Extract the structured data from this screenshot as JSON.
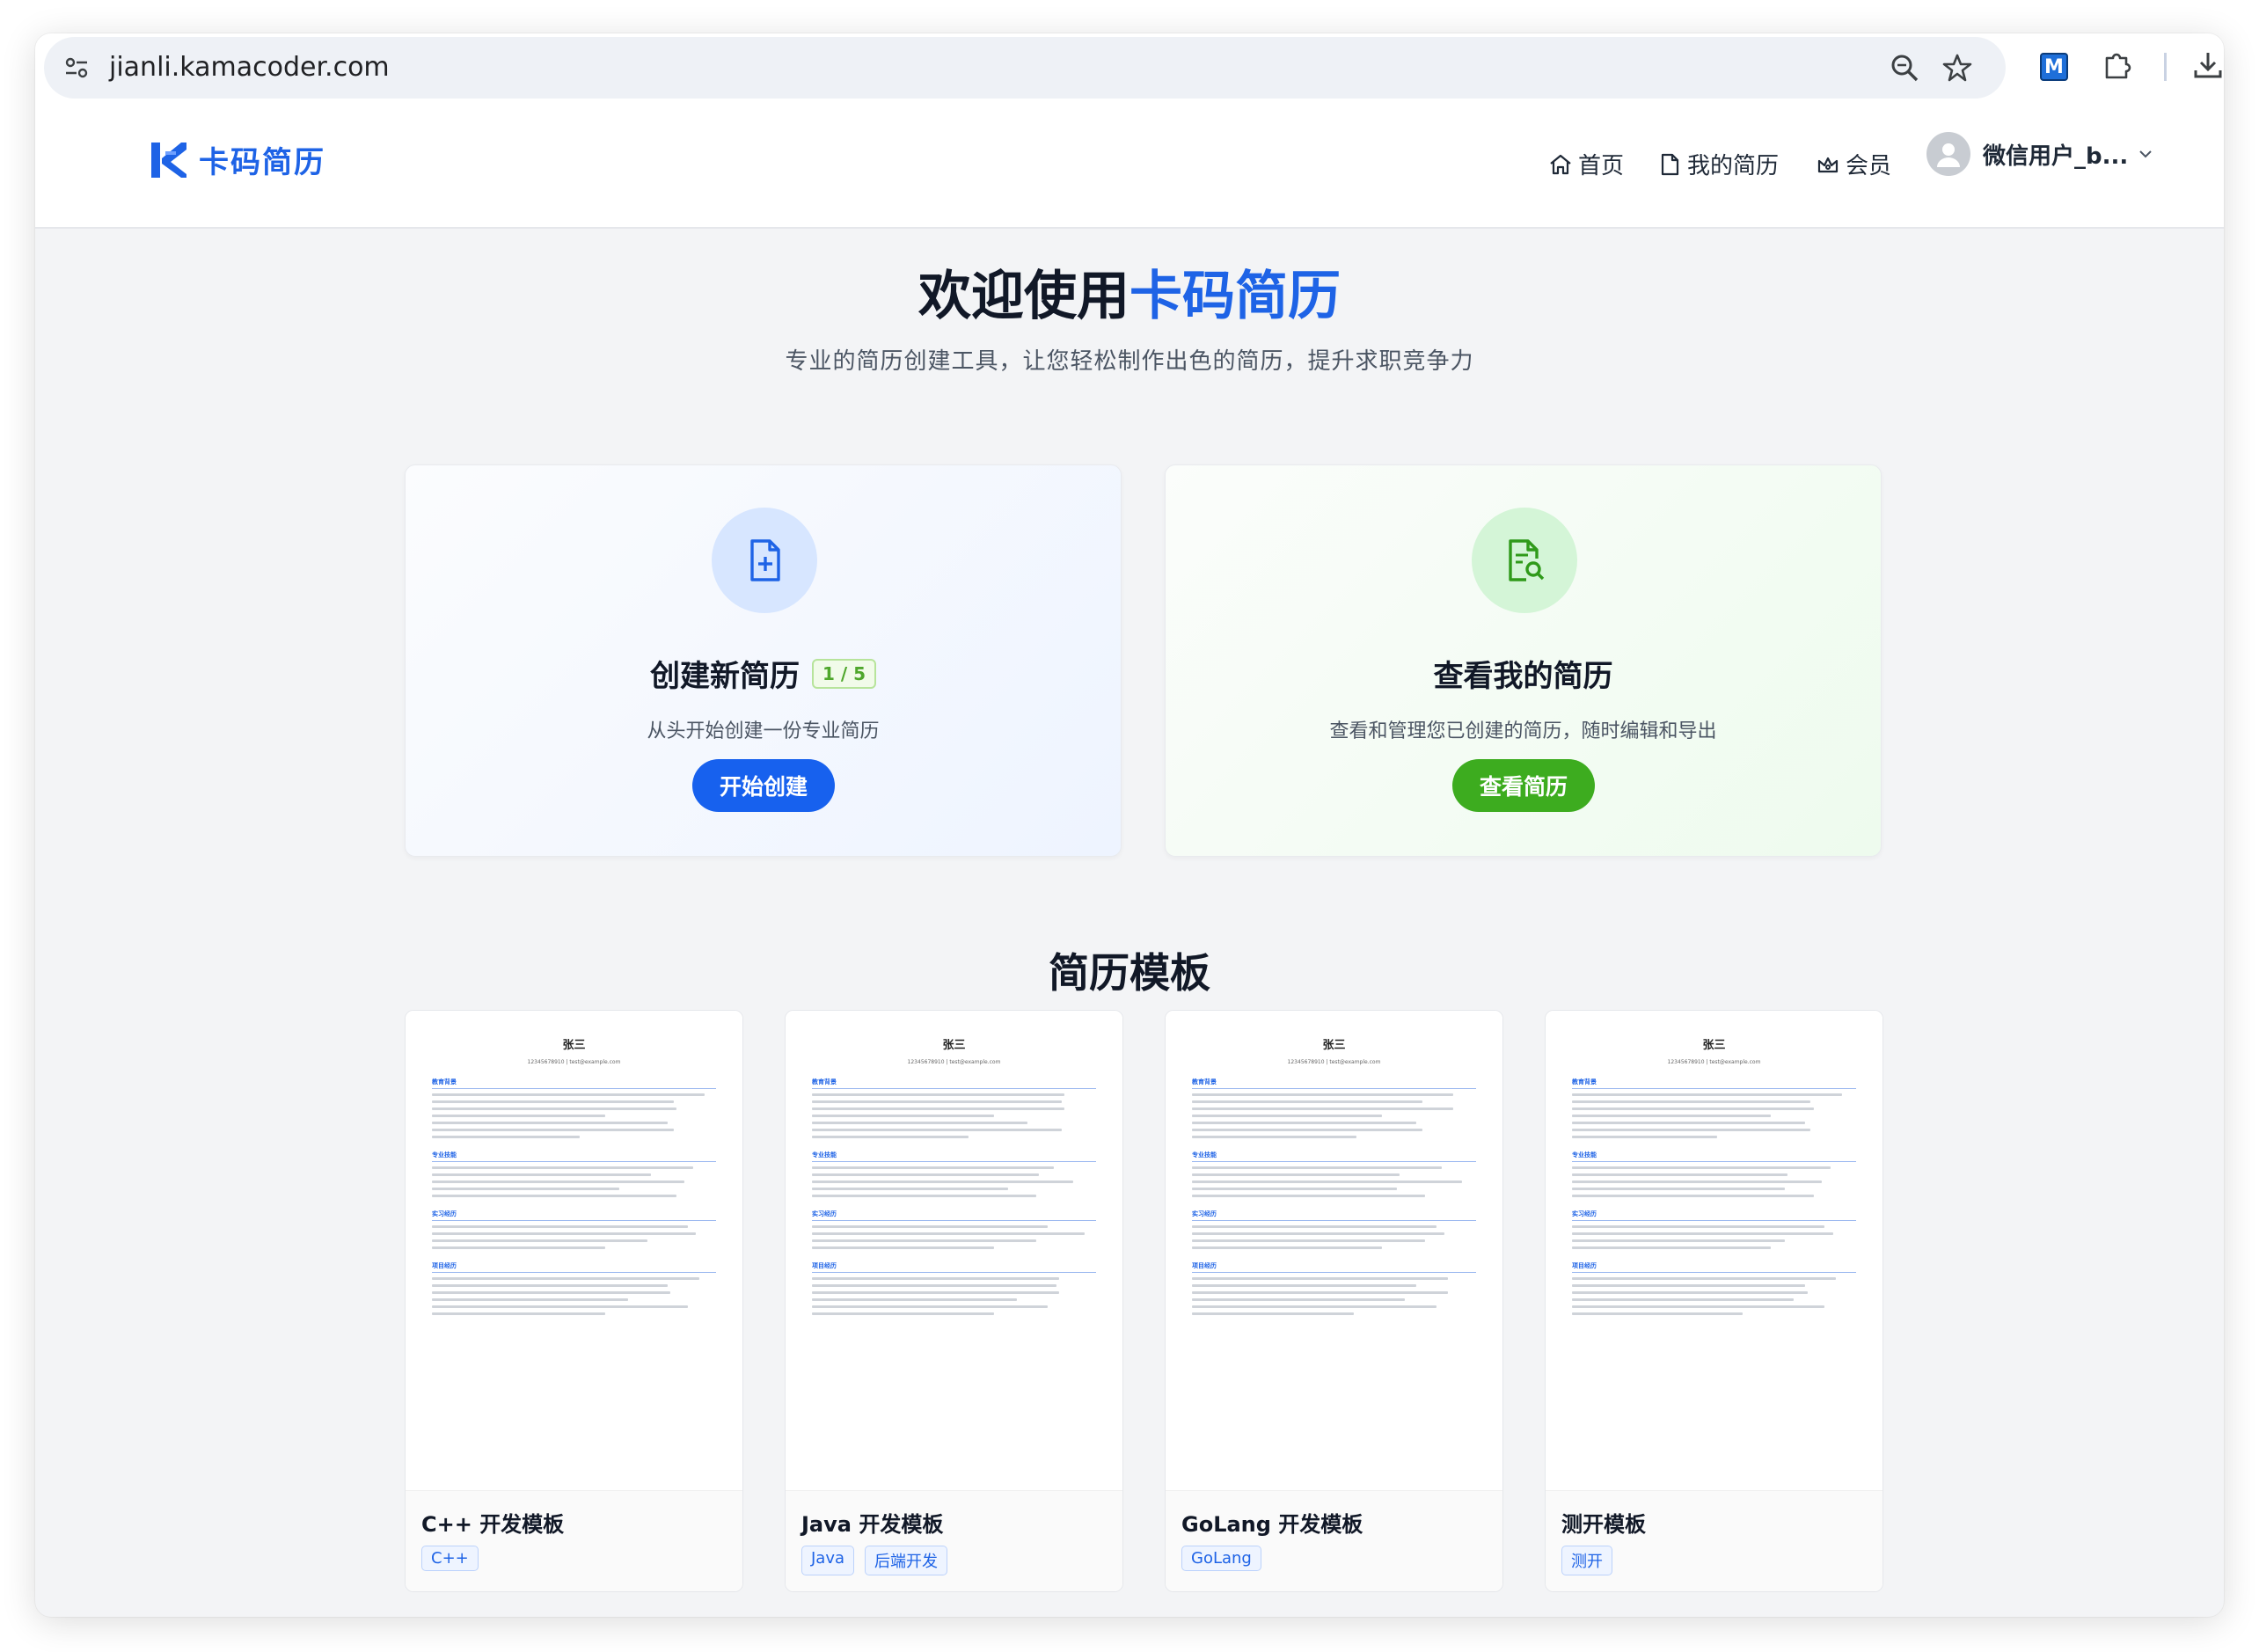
{
  "browser": {
    "url": "jianli.kamacoder.com",
    "extension_label": "M"
  },
  "site": {
    "logo_text": "卡码简历",
    "nav": {
      "home": "首页",
      "my_resumes": "我的简历",
      "member": "会员"
    },
    "user_name": "微信用户_b..."
  },
  "hero": {
    "title_prefix": "欢迎使用",
    "title_accent": "卡码简历",
    "subtitle": "专业的简历创建工具，让您轻松制作出色的简历，提升求职竞争力"
  },
  "cards": {
    "create": {
      "title": "创建新简历",
      "quota": "1 / 5",
      "desc": "从头开始创建一份专业简历",
      "button": "开始创建"
    },
    "view": {
      "title": "查看我的简历",
      "desc": "查看和管理您已创建的简历，随时编辑和导出",
      "button": "查看简历"
    }
  },
  "templates": {
    "section_title": "简历模板",
    "preview_name": "张三",
    "preview_contact": "12345678910  |  test@example.com",
    "preview_sections": [
      "教育背景",
      "专业技能",
      "实习经历",
      "项目经历"
    ],
    "items": [
      {
        "name": "C++ 开发模板",
        "tags": [
          "C++"
        ]
      },
      {
        "name": "Java 开发模板",
        "tags": [
          "Java",
          "后端开发"
        ]
      },
      {
        "name": "GoLang 开发模板",
        "tags": [
          "GoLang"
        ]
      },
      {
        "name": "测开模板",
        "tags": [
          "测开"
        ]
      }
    ]
  },
  "colors": {
    "brand_blue": "#1e63e6",
    "create_button": "#1761ee",
    "view_button": "#3dac1f",
    "quota_green": "#4fa72c"
  }
}
